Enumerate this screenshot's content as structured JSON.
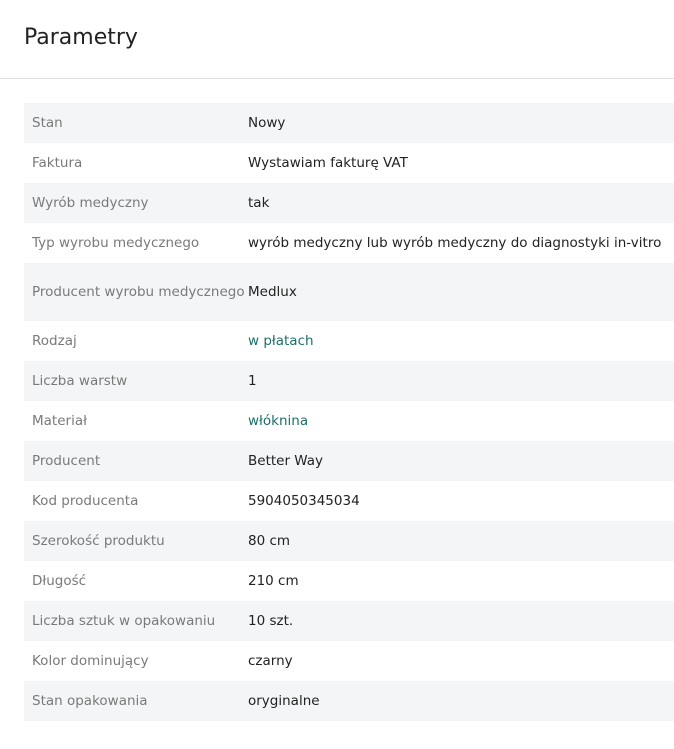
{
  "header": {
    "title": "Parametry"
  },
  "params": [
    {
      "label": "Stan",
      "value": "Nowy"
    },
    {
      "label": "Faktura",
      "value": "Wystawiam fakturę VAT"
    },
    {
      "label": "Wyrób medyczny",
      "value": "tak"
    },
    {
      "label": "Typ wyrobu medycznego",
      "value": "wyrób medyczny lub wyrób medyczny do diagnostyki in-vitro"
    },
    {
      "label": "Producent wyrobu medycznego",
      "value": "Medlux"
    },
    {
      "label": "Rodzaj",
      "value": "w płatach",
      "link": true
    },
    {
      "label": "Liczba warstw",
      "value": "1"
    },
    {
      "label": "Materiał",
      "value": "włóknina",
      "link": true
    },
    {
      "label": "Producent",
      "value": "Better Way"
    },
    {
      "label": "Kod producenta",
      "value": "5904050345034"
    },
    {
      "label": "Szerokość produktu",
      "value": "80 cm"
    },
    {
      "label": "Długość",
      "value": "210 cm"
    },
    {
      "label": "Liczba sztuk w opakowaniu",
      "value": "10 szt."
    },
    {
      "label": "Kolor dominujący",
      "value": "czarny"
    },
    {
      "label": "Stan opakowania",
      "value": "oryginalne"
    }
  ],
  "colors": {
    "link": "#1f6f6a",
    "label": "#7a7a7a",
    "stripe": "#f4f5f6"
  }
}
